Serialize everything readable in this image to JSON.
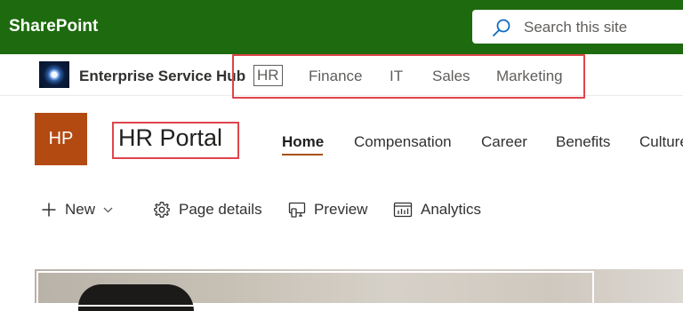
{
  "app": {
    "name": "SharePoint"
  },
  "search": {
    "placeholder": "Search this site"
  },
  "hub": {
    "name": "Enterprise Service Hub",
    "nav": [
      "HR",
      "Finance",
      "IT",
      "Sales",
      "Marketing"
    ]
  },
  "site": {
    "logo_initials": "HP",
    "title": "HR Portal",
    "nav": [
      "Home",
      "Compensation",
      "Career",
      "Benefits",
      "Culture"
    ],
    "active_nav": "Home"
  },
  "commands": {
    "new": "New",
    "page_details": "Page details",
    "preview": "Preview",
    "analytics": "Analytics"
  },
  "icons": {
    "search": "search-icon",
    "add": "plus-icon",
    "chevron": "chevron-down-icon",
    "settings": "gear-icon",
    "preview": "preview-icon",
    "analytics": "analytics-icon"
  },
  "colors": {
    "suite_bar": "#1e6a0e",
    "logo_bg": "#b34a12",
    "active_underline": "#a85014",
    "highlight_box": "#e0444b",
    "search_icon": "#0f6cbd"
  }
}
